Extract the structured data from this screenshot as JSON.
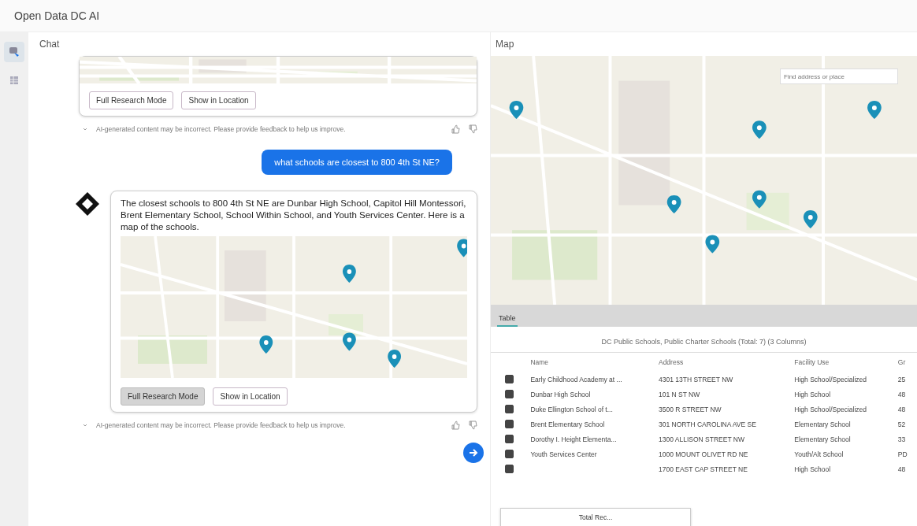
{
  "app_title": "Open Data DC AI",
  "sidebar": {
    "items": [
      {
        "selected": true
      },
      {
        "selected": false
      }
    ]
  },
  "chat": {
    "title": "Chat",
    "previous_reply": {
      "buttons": [
        {
          "label": "Full Research Mode",
          "selected": false
        },
        {
          "label": "Show in Location",
          "selected": false
        }
      ],
      "footer": "AI-generated content may be incorrect. Please provide feedback to help us improve."
    },
    "user_message": "what schools are closest to 800 4th St NE?",
    "reply": {
      "text": "The closest schools to 800 4th St NE are Dunbar High School, Capitol Hill Montessori, Brent Elementary School, School Within School, and Youth Services Center. Here is a map of the schools.",
      "buttons": [
        {
          "label": "Full Research Mode",
          "selected": true
        },
        {
          "label": "Show in Location",
          "selected": false
        }
      ],
      "footer": "AI-generated content may be incorrect. Please provide feedback to help us improve."
    }
  },
  "map": {
    "title": "Map",
    "search_placeholder": "Find address or place"
  },
  "table": {
    "tab": "Table",
    "title": "DC Public Schools, Public Charter Schools (Total: 7) (3 Columns)",
    "columns": [
      "Name",
      "Address",
      "Facility Use",
      "Gr"
    ],
    "rows": [
      {
        "checked": true,
        "cells": [
          "Early Childhood Academy at ...",
          "4301 13TH STREET NW",
          "High School/Specialized",
          "25"
        ]
      },
      {
        "checked": true,
        "cells": [
          "Dunbar High School",
          "101 N ST NW",
          "High School",
          "48"
        ]
      },
      {
        "checked": true,
        "cells": [
          "Duke Ellington School of t...",
          "3500 R STREET NW",
          "High School/Specialized",
          "48"
        ]
      },
      {
        "checked": true,
        "cells": [
          "Brent Elementary School",
          "301 NORTH CAROLINA AVE SE",
          "Elementary School",
          "52"
        ]
      },
      {
        "checked": true,
        "cells": [
          "Dorothy I. Height Elementa...",
          "1300 ALLISON STREET NW",
          "Elementary School",
          "33"
        ]
      },
      {
        "checked": true,
        "cells": [
          "Youth Services Center",
          "1000 MOUNT OLIVET RD NE",
          "Youth/Alt School",
          "PD"
        ]
      },
      {
        "checked": true,
        "cells": [
          "",
          "1700 EAST CAP STREET NE",
          "High School",
          "48"
        ]
      }
    ],
    "pager": "Total Rec..."
  }
}
